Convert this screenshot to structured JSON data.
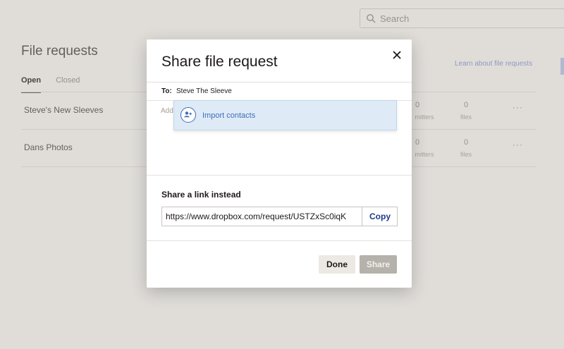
{
  "search": {
    "placeholder": "Search"
  },
  "page": {
    "title": "File requests",
    "learn_link": "Learn about file requests",
    "tabs": [
      {
        "label": "Open"
      },
      {
        "label": "Closed"
      }
    ],
    "rows": [
      {
        "name": "Steve's New Sleeves",
        "submitters_count": "0",
        "submitters_label": "mitters",
        "files_count": "0",
        "files_label": "files",
        "more": "···"
      },
      {
        "name": "Dans Photos",
        "submitters_count": "0",
        "submitters_label": "mitters",
        "files_count": "0",
        "files_label": "files",
        "more": "···"
      }
    ]
  },
  "modal": {
    "title": "Share file request",
    "close_icon": "close-icon",
    "to_label": "To:",
    "to_value": "Steve The Sleeve",
    "add_message_label": "Add",
    "dropdown": {
      "label": "Import contacts",
      "icon": "add-contact-icon"
    },
    "share_link_title": "Share a link instead",
    "link_url": "https://www.dropbox.com/request/USTZxSc0iqK",
    "copy_label": "Copy",
    "done_label": "Done",
    "share_label": "Share"
  },
  "colors": {
    "accent_blue": "#3c6fb8",
    "copy_blue": "#1e3a8a",
    "dropdown_bg": "#deeaf6",
    "share_disabled": "#b5b1ab"
  }
}
